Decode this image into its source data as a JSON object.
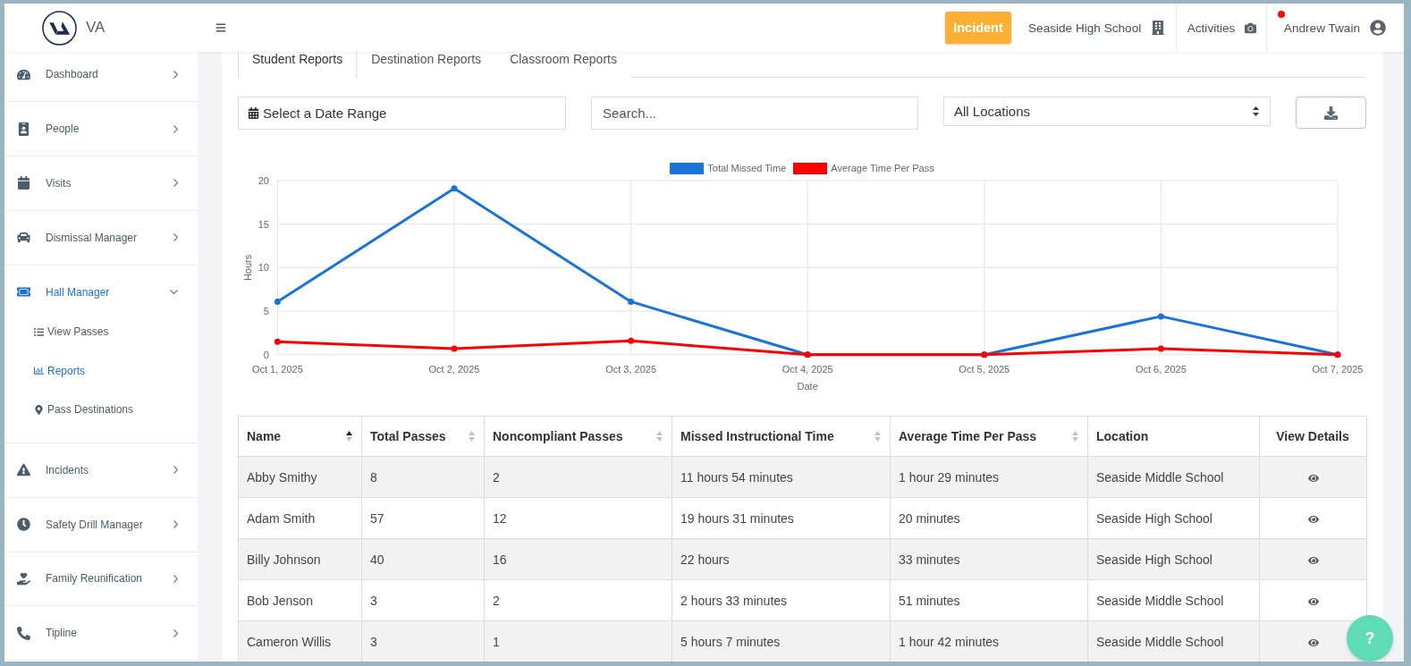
{
  "header": {
    "logo_text": "VA",
    "incident_button": "Incident",
    "school": "Seaside High School",
    "activities": "Activities",
    "user": {
      "name": "Andrew Twain",
      "has_notification": true
    }
  },
  "sidebar": {
    "items": [
      {
        "label": "Dashboard",
        "expanded": false
      },
      {
        "label": "People",
        "expanded": false
      },
      {
        "label": "Visits",
        "expanded": false
      },
      {
        "label": "Dismissal Manager",
        "expanded": false
      },
      {
        "label": "Hall Manager",
        "expanded": true,
        "children": [
          {
            "label": "View Passes",
            "selected": false
          },
          {
            "label": "Reports",
            "selected": true
          },
          {
            "label": "Pass Destinations",
            "selected": false
          }
        ]
      },
      {
        "label": "Incidents",
        "expanded": false
      },
      {
        "label": "Safety Drill Manager",
        "expanded": false
      },
      {
        "label": "Family Reunification",
        "expanded": false
      },
      {
        "label": "Tipline",
        "expanded": false
      }
    ]
  },
  "tabs": [
    {
      "label": "Student Reports",
      "selected": true
    },
    {
      "label": "Destination Reports",
      "selected": false
    },
    {
      "label": "Classroom Reports",
      "selected": false
    }
  ],
  "filters": {
    "date_range": "Select a Date Range",
    "search": {
      "placeholder": "Search..."
    },
    "location": "All Locations"
  },
  "chart": {
    "chart_data": {
      "type": "line",
      "xlabel": "Date",
      "ylabel": "Hours",
      "categories": [
        "Oct 1, 2025",
        "Oct 2, 2025",
        "Oct 3, 2025",
        "Oct 4, 2025",
        "Oct 5, 2025",
        "Oct 6, 2025",
        "Oct 7, 2025"
      ],
      "series": [
        {
          "name": "Total Missed Time",
          "color": "#1a74d8",
          "marker": "circle",
          "values": [
            6.1,
            19.1,
            6.1,
            0,
            0,
            4.4,
            0
          ]
        },
        {
          "name": "Average Time Per Pass",
          "color": "#ff0000",
          "marker": "circle",
          "values": [
            1.5,
            0.7,
            1.6,
            0,
            0,
            0.7,
            0
          ]
        }
      ],
      "ylim": [
        0,
        20
      ],
      "yticks": [
        0,
        5,
        10,
        15,
        20
      ],
      "grid": true,
      "legend": true
    }
  },
  "table": {
    "columns": [
      {
        "label": "Name",
        "sortable": true,
        "sorted": true
      },
      {
        "label": "Total Passes",
        "sortable": true,
        "sorted": false
      },
      {
        "label": "Noncompliant Passes",
        "sortable": true,
        "sorted": false
      },
      {
        "label": "Missed Instructional Time",
        "sortable": true,
        "sorted": false
      },
      {
        "label": "Average Time Per Pass",
        "sortable": true,
        "sorted": false
      },
      {
        "label": "Location",
        "sortable": false
      },
      {
        "label": "View Details",
        "sortable": false
      }
    ],
    "rows": [
      {
        "cells": [
          "Abby Smithy",
          "8",
          "2",
          "11 hours 54 minutes",
          "1 hour 29 minutes",
          "Seaside Middle School"
        ]
      },
      {
        "cells": [
          "Adam Smith",
          "57",
          "12",
          "19 hours 31 minutes",
          "20 minutes",
          "Seaside High School"
        ]
      },
      {
        "cells": [
          "Billy Johnson",
          "40",
          "16",
          "22 hours",
          "33 minutes",
          "Seaside High School"
        ]
      },
      {
        "cells": [
          "Bob Jenson",
          "3",
          "2",
          "2 hours 33 minutes",
          "51 minutes",
          "Seaside Middle School"
        ]
      },
      {
        "cells": [
          "Cameron Willis",
          "3",
          "1",
          "5 hours 7 minutes",
          "1 hour 42 minutes",
          "Seaside Middle School"
        ]
      }
    ]
  },
  "help_button": "?"
}
